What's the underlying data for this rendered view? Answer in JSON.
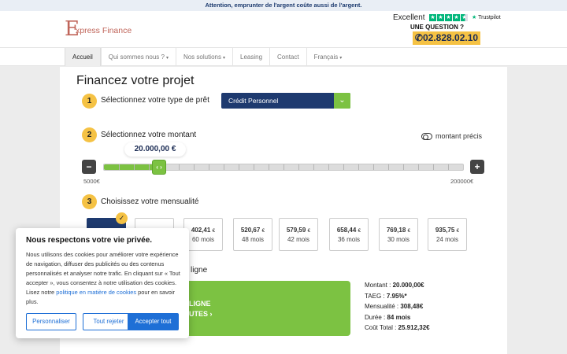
{
  "topbar": {
    "warning": "Attention, emprunter de l'argent coûte aussi de l'argent."
  },
  "header": {
    "logo_letter": "E",
    "logo_text": "xpress Finance",
    "trustpilot": {
      "rating_word": "Excellent",
      "brand": "Trustpilot",
      "stars": 4.5
    },
    "question": "UNE QUESTION ?",
    "phone": "02.828.02.10"
  },
  "nav": {
    "items": [
      {
        "label": "Accueil",
        "active": true,
        "dropdown": false
      },
      {
        "label": "Qui sommes nous ?",
        "active": false,
        "dropdown": true
      },
      {
        "label": "Nos solutions",
        "active": false,
        "dropdown": true
      },
      {
        "label": "Leasing",
        "active": false,
        "dropdown": false
      },
      {
        "label": "Contact",
        "active": false,
        "dropdown": false
      },
      {
        "label": "Français",
        "active": false,
        "dropdown": true
      }
    ]
  },
  "main": {
    "title": "Financez votre projet",
    "step1": {
      "number": "1",
      "label": "Sélectionnez votre type de prêt",
      "selected": "Crédit Personnel"
    },
    "step2": {
      "number": "2",
      "label": "Sélectionnez votre montant",
      "precise_toggle": "montant précis",
      "amount": "20.000,00 €",
      "amount_fraction": 0.155,
      "min": "5000€",
      "max": "200000€",
      "minus": "−",
      "plus": "+",
      "handle": "‹ ›"
    },
    "step3": {
      "number": "3",
      "label": "Choisissez votre mensualité",
      "options": [
        {
          "amount": "",
          "currency": "",
          "months": "",
          "selected": true
        },
        {
          "amount": "",
          "currency": "",
          "months": "",
          "selected": false
        },
        {
          "amount": "402,41",
          "currency": "€",
          "months": "60 mois",
          "selected": false
        },
        {
          "amount": "520,67",
          "currency": "€",
          "months": "48 mois",
          "selected": false
        },
        {
          "amount": "579,59",
          "currency": "€",
          "months": "42 mois",
          "selected": false
        },
        {
          "amount": "658,44",
          "currency": "€",
          "months": "36 mois",
          "selected": false
        },
        {
          "amount": "769,18",
          "currency": "€",
          "months": "30 mois",
          "selected": false
        },
        {
          "amount": "935,75",
          "currency": "€",
          "months": "24 mois",
          "selected": false
        }
      ]
    },
    "online_tail": "ligne",
    "cta": {
      "line1": "LIGNE",
      "line2": "UTES ›"
    },
    "summary": [
      {
        "label": "Montant : ",
        "value": "20.000,00€"
      },
      {
        "label": "TAEG  :  ",
        "value": "7.95%*"
      },
      {
        "label": "Mensualité : ",
        "value": "308,48€"
      },
      {
        "label": "Durée : ",
        "value": "84 mois"
      },
      {
        "label": "Coût Total : ",
        "value": "25.912,32€"
      }
    ]
  },
  "cookie": {
    "title": "Nous respectons votre vie privée.",
    "text_before": "Nous utilisons des cookies pour améliorer votre expérience de navigation, diffuser des publicités ou des contenus personnalisés et analyser notre trafic. En cliquant sur « Tout accepter », vous consentez à notre utilisation des cookies. Lisez notre ",
    "link": "politique en matière de cookies",
    "text_after": " pour en savoir plus.",
    "buttons": {
      "customize": "Personnaliser",
      "reject": "Tout rejeter",
      "accept": "Accepter tout"
    }
  },
  "colors": {
    "navy": "#1e3a6f",
    "green": "#7cc242",
    "yellow": "#f5c244",
    "link_blue": "#1e6fd6",
    "logo": "#c0655a"
  }
}
